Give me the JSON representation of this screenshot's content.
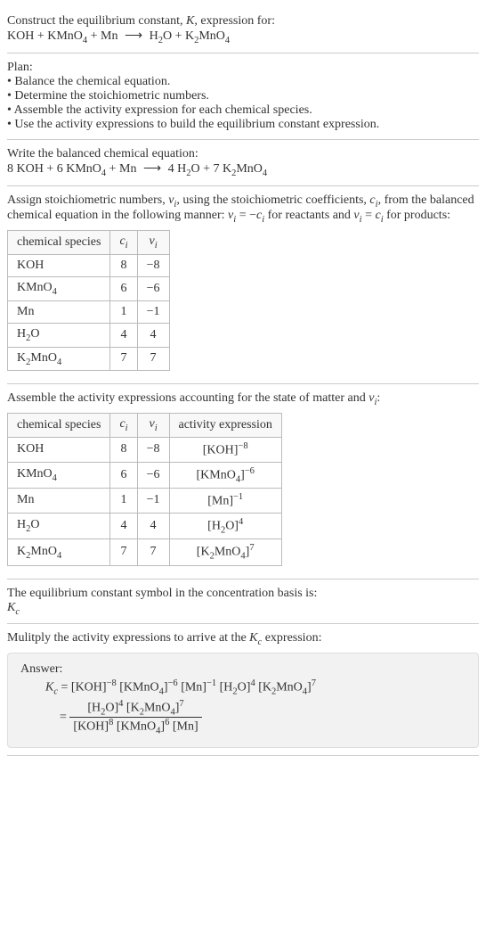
{
  "intro": {
    "line1": "Construct the equilibrium constant, ",
    "K": "K",
    "line1b": ", expression for:",
    "eq_lhs": "KOH + KMnO",
    "eq_lhs2": " + Mn",
    "arrow": "⟶",
    "eq_rhs1": "H",
    "eq_rhs2": "O + K",
    "eq_rhs3": "MnO"
  },
  "plan": {
    "header": "Plan:",
    "b1": "• Balance the chemical equation.",
    "b2": "• Determine the stoichiometric numbers.",
    "b3": "• Assemble the activity expression for each chemical species.",
    "b4": "• Use the activity expressions to build the equilibrium constant expression."
  },
  "balanced": {
    "header": "Write the balanced chemical equation:",
    "lhs": "8 KOH + 6 KMnO",
    "lhs2": " + Mn",
    "arrow": "⟶",
    "rhs1": "4 H",
    "rhs2": "O + 7 K",
    "rhs3": "MnO"
  },
  "assign": {
    "p1": "Assign stoichiometric numbers, ",
    "nu": "ν",
    "p2": ", using the stoichiometric coefficients, ",
    "c": "c",
    "p3": ", from the balanced chemical equation in the following manner: ",
    "eq1a": "ν",
    "eq1b": " = −",
    "eq1c": "c",
    "p4": " for reactants and ",
    "eq2a": "ν",
    "eq2b": " = ",
    "eq2c": "c",
    "p5": " for products:"
  },
  "table1": {
    "h1": "chemical species",
    "h2": "c",
    "h3": "ν",
    "rows": [
      {
        "sp": "KOH",
        "c": "8",
        "v": "−8"
      },
      {
        "sp": "KMnO4",
        "c": "6",
        "v": "−6"
      },
      {
        "sp": "Mn",
        "c": "1",
        "v": "−1"
      },
      {
        "sp": "H2O",
        "c": "4",
        "v": "4"
      },
      {
        "sp": "K2MnO4",
        "c": "7",
        "v": "7"
      }
    ]
  },
  "assemble": {
    "p1": "Assemble the activity expressions accounting for the state of matter and ",
    "nu": "ν",
    "p2": ":"
  },
  "table2": {
    "h1": "chemical species",
    "h2": "c",
    "h3": "ν",
    "h4": "activity expression",
    "rows": [
      {
        "sp": "KOH",
        "c": "8",
        "v": "−8",
        "ae_base": "[KOH]",
        "ae_exp": "−8"
      },
      {
        "sp": "KMnO4",
        "c": "6",
        "v": "−6",
        "ae_base": "[KMnO",
        "ae_exp": "−6"
      },
      {
        "sp": "Mn",
        "c": "1",
        "v": "−1",
        "ae_base": "[Mn]",
        "ae_exp": "−1"
      },
      {
        "sp": "H2O",
        "c": "4",
        "v": "4",
        "ae_base": "[H",
        "ae_exp": "4"
      },
      {
        "sp": "K2MnO4",
        "c": "7",
        "v": "7",
        "ae_base": "[K",
        "ae_exp": "7"
      }
    ]
  },
  "symbol": {
    "p1": "The equilibrium constant symbol in the concentration basis is:",
    "kc": "K",
    "kcsub": "c"
  },
  "mult": {
    "p1": "Mulitply the activity expressions to arrive at the ",
    "kc": "K",
    "kcsub": "c",
    "p2": " expression:"
  },
  "answer": {
    "label": "Answer:",
    "kc": "K",
    "kcsub": "c",
    "eq": " = [KOH]",
    "e1": "−8",
    "t2": " [KMnO",
    "e2": "−6",
    "t3": " [Mn]",
    "e3": "−1",
    "t4": " [H",
    "e4": "4",
    "t5": " [K",
    "e5": "7",
    "eq2_prefix": "= ",
    "num1": "[H",
    "num1e": "4",
    "num2": " [K",
    "num2e": "7",
    "den1": "[KOH]",
    "den1e": "8",
    "den2": " [KMnO",
    "den2e": "6",
    "den3": " [Mn]"
  }
}
